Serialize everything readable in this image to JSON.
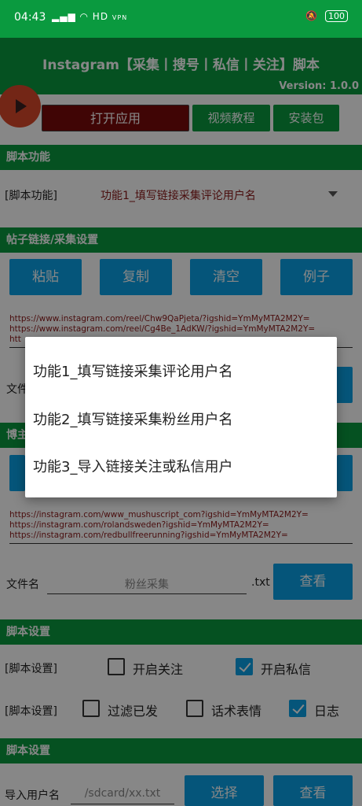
{
  "status": {
    "time": "04:43",
    "signal": "HD",
    "vpn": "VPN",
    "battery": "100"
  },
  "header": {
    "title": "Instagram【采集丨搜号丨私信丨关注】脚本",
    "version": "Version: 1.0.0"
  },
  "top_buttons": {
    "open_app": "打开应用",
    "video_tutorial": "视频教程",
    "install_pkg": "安装包"
  },
  "script_function": {
    "section": "脚本功能",
    "label": "[脚本功能]",
    "selected": "功能1_填写链接采集评论用户名"
  },
  "post_links": {
    "section": "帖子链接/采集设置",
    "buttons": [
      "粘贴",
      "复制",
      "清空",
      "例子"
    ],
    "links": [
      "https://www.instagram.com/reel/Chw9QaPjeta/?igshid=YmMyMTA2M2Y=",
      "https://www.instagram.com/reel/Cg4Be_1AdKW/?igshid=YmMyMTA2M2Y=",
      "htt"
    ],
    "file_label": "文件"
  },
  "blogger": {
    "section_partial": "博主",
    "links": [
      "https://instagram.com/www_mushuscript_com?igshid=YmMyMTA2M2Y=",
      "https://instagram.com/rolandsweden?igshid=YmMyMTA2M2Y=",
      "https://instagram.com/redbullfreerunning?igshid=YmMyMTA2M2Y="
    ],
    "file_label": "文件名",
    "file_placeholder": "粉丝采集",
    "ext": ".txt",
    "view_button": "查看"
  },
  "settings": {
    "section": "脚本设置",
    "label": "[脚本设置]",
    "row1": [
      {
        "label": "开启关注",
        "checked": false
      },
      {
        "label": "开启私信",
        "checked": true
      }
    ],
    "row2": [
      {
        "label": "过滤已发",
        "checked": false
      },
      {
        "label": "话术表情",
        "checked": false
      },
      {
        "label": "日志",
        "checked": true
      }
    ]
  },
  "import": {
    "section": "脚本设置",
    "label": "导入用户名",
    "path_placeholder": "/sdcard/xx.txt",
    "select_button": "选择",
    "view_button": "查看"
  },
  "dialog": {
    "options": [
      "功能1_填写链接采集评论用户名",
      "功能2_填写链接采集粉丝用户名",
      "功能3_导入链接关注或私信用户"
    ]
  },
  "colors": {
    "green": "#0a9a3f",
    "blue": "#0aa0e6",
    "dark_red": "#7a0a0a",
    "fab_red": "#d9482a"
  }
}
